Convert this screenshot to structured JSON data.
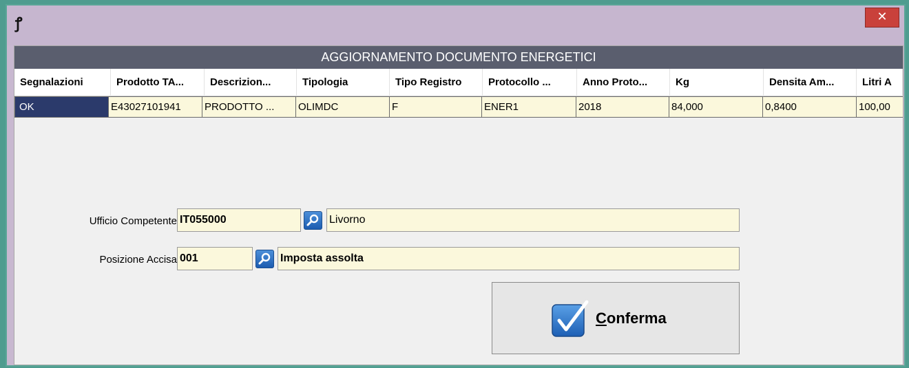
{
  "window": {
    "app_icon": "ꝭ",
    "close_glyph": "✕",
    "colors": {
      "titlebar": "#c6b6cf",
      "close": "#c9413b",
      "grid_header_band": "#5a5e6e",
      "selection": "#2b3a6b",
      "field_bg": "#fbf8dc"
    }
  },
  "grid": {
    "title": "AGGIORNAMENTO DOCUMENTO ENERGETICI",
    "columns": [
      "Segnalazioni",
      "Prodotto TA...",
      "Descrizion...",
      "Tipologia",
      "Tipo Registro",
      "Protocollo ...",
      "Anno Proto...",
      "Kg",
      "Densita Am...",
      "Litri A"
    ],
    "rows": [
      [
        "OK",
        "E43027101941",
        "PRODOTTO ...",
        "OLIMDC",
        "F",
        "ENER1",
        "2018",
        "84,000",
        "0,8400",
        "100,00"
      ]
    ]
  },
  "scrollbar": {
    "left_arrow": "<",
    "right_arrow": ">"
  },
  "form": {
    "ufficio": {
      "label": "Ufficio Competente",
      "code": "IT055000",
      "description": "Livorno"
    },
    "posizione": {
      "label": "Posizione Accisa",
      "code": "001",
      "description": "Imposta assolta"
    }
  },
  "confirm": {
    "mnemonic": "C",
    "rest": "onferma"
  }
}
